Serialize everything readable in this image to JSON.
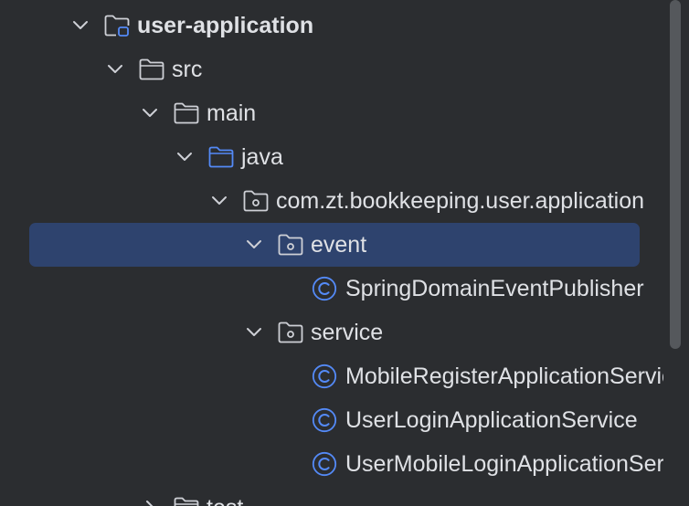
{
  "project_tree": {
    "items": [
      {
        "label": "user-application",
        "kind": "module-folder",
        "expanded": true,
        "bold": true
      },
      {
        "label": "src",
        "kind": "folder",
        "expanded": true
      },
      {
        "label": "main",
        "kind": "folder",
        "expanded": true
      },
      {
        "label": "java",
        "kind": "source-root",
        "expanded": true
      },
      {
        "label": "com.zt.bookkeeping.user.application",
        "kind": "package",
        "expanded": true
      },
      {
        "label": "event",
        "kind": "package",
        "expanded": true,
        "selected": true
      },
      {
        "label": "SpringDomainEventPublisher",
        "kind": "class"
      },
      {
        "label": "service",
        "kind": "package",
        "expanded": true
      },
      {
        "label": "MobileRegisterApplicationService",
        "kind": "class"
      },
      {
        "label": "UserLoginApplicationService",
        "kind": "class"
      },
      {
        "label": "UserMobileLoginApplicationService",
        "kind": "class"
      },
      {
        "label": "test",
        "kind": "folder",
        "expanded": false
      }
    ]
  },
  "icons": {
    "chevron_expanded": "chevron-down-icon",
    "chevron_collapsed": "chevron-right-icon",
    "folder": "folder-icon",
    "module_folder": "module-folder-icon",
    "source_root": "source-root-folder-icon",
    "package": "package-icon",
    "class": "class-icon"
  },
  "colors": {
    "background": "#2b2d30",
    "selection": "#2e436e",
    "text": "#dfe1e5",
    "icon_gray": "#ced0d6",
    "source_root_blue": "#548af7",
    "class_icon_blue": "#548af7"
  }
}
